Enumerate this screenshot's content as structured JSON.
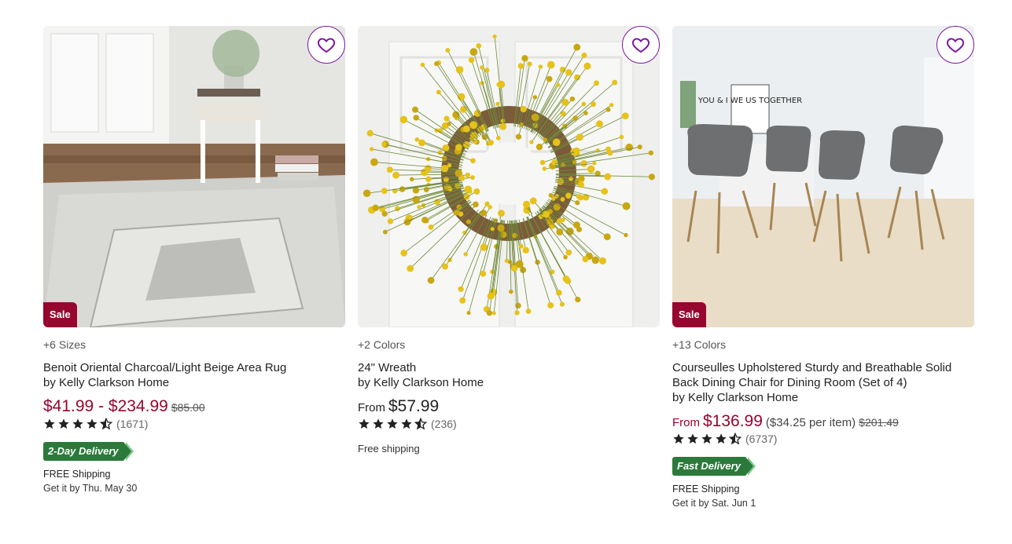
{
  "products": [
    {
      "options": "+6 Sizes",
      "name": "Benoit Oriental Charcoal/Light Beige Area Rug",
      "brand": "by Kelly Clarkson Home",
      "price": "$41.99 - $234.99",
      "was_price": "$85.00",
      "rating": 4.5,
      "reviews": "(1671)",
      "sale_label": "Sale",
      "delivery_badge": "2-Day Delivery",
      "shipping": "FREE Shipping",
      "eta": "Get it by Thu. May 30",
      "image_icon": "area-rug-image"
    },
    {
      "options": "+2 Colors",
      "name": "24\" Wreath",
      "brand": "by Kelly Clarkson Home",
      "price_prefix": "From",
      "price": "$57.99",
      "rating": 4.5,
      "reviews": "(236)",
      "shipping": "Free shipping",
      "image_icon": "yellow-wreath-image"
    },
    {
      "options": "+13 Colors",
      "name": "Courseulles Upholstered Sturdy and Breathable Solid Back Dining Chair for Dining Room (Set of 4)",
      "brand": "by Kelly Clarkson Home",
      "price_prefix": "From",
      "price": "$136.99",
      "per_item": "($34.25 per item)",
      "was_price": "$201.49",
      "rating": 4.5,
      "reviews": "(6737)",
      "sale_label": "Sale",
      "delivery_badge": "Fast Delivery",
      "shipping": "FREE Shipping",
      "eta": "Get it by Sat. Jun 1",
      "image_icon": "dining-chairs-image"
    }
  ],
  "sign_text": "YOU & I WE US TOGETHER",
  "colors": {
    "sale_red": "#96062e",
    "favorite_purple": "#7b189f",
    "delivery_green": "#2b7a3b",
    "star": "#222222"
  }
}
